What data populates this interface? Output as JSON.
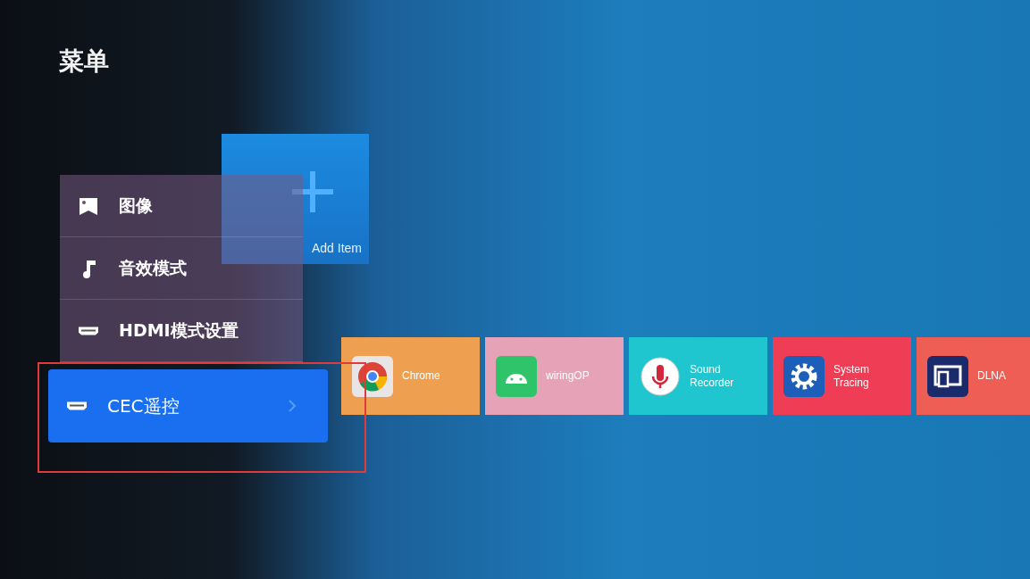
{
  "add_tile": {
    "label": "Add Item"
  },
  "apps": [
    {
      "label": "Chrome",
      "color": "#ee9f4f"
    },
    {
      "label": "wiringOP",
      "color": "#e6a2b6"
    },
    {
      "label": "Sound Recorder",
      "color": "#1fc6cf"
    },
    {
      "label": "System Tracing",
      "color": "#ee3d55"
    },
    {
      "label": "DLNA",
      "color": "#ef5e55"
    }
  ],
  "menu": {
    "title": "菜单",
    "items": [
      {
        "label": "图像",
        "selected": false,
        "annotated": false
      },
      {
        "label": "音效模式",
        "selected": false,
        "annotated": false
      },
      {
        "label": "HDMI模式设置",
        "selected": false,
        "annotated": false
      },
      {
        "label": "CEC遥控",
        "selected": true,
        "annotated": true
      }
    ]
  }
}
